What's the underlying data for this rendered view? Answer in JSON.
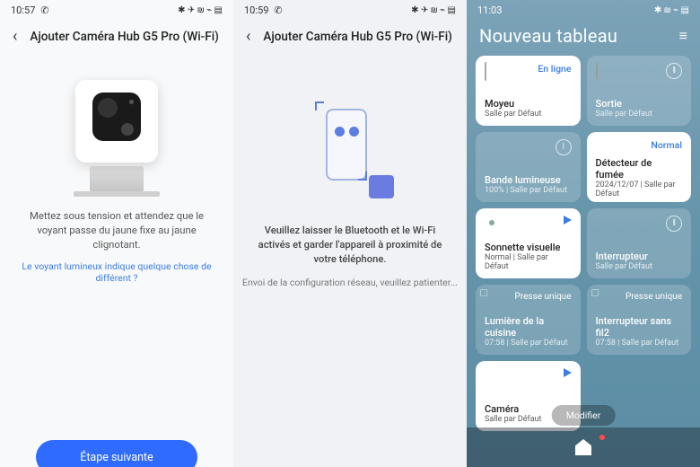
{
  "screen1": {
    "time": "10:57",
    "status_icons": "✱ ⚡ ⚲ ⛢ ⚞ ⚡",
    "title": "Ajouter Caméra Hub G5 Pro (Wi-Fi)",
    "instruction": "Mettez sous tension et attendez que le voyant passe du jaune fixe au jaune clignotant.",
    "help_link": "Le voyant lumineux indique quelque chose de différent ?",
    "next_button": "Étape suivante"
  },
  "screen2": {
    "time": "10:59",
    "title": "Ajouter Caméra Hub G5 Pro (Wi-Fi)",
    "instruction": "Veuillez laisser le Bluetooth et le Wi-Fi activés et garder l'appareil à proximité de votre téléphone.",
    "sending": "Envoi de la configuration réseau, veuillez patienter..."
  },
  "screen3": {
    "time": "11:03",
    "board_title": "Nouveau tableau",
    "modify": "Modifier",
    "tiles": [
      {
        "name": "Moyeu",
        "sub": "Salle par Défaut",
        "state": "En ligne",
        "state_kind": "online",
        "tone": "light",
        "icon": "hub"
      },
      {
        "name": "Sortie",
        "sub": "Salle par Défaut",
        "state_kind": "power",
        "tone": "dark",
        "icon": "outlet"
      },
      {
        "name": "Bande lumineuse",
        "sub": "100% | Salle par Défaut",
        "state_kind": "power",
        "tone": "dark",
        "icon": "bulb"
      },
      {
        "name": "Détecteur de fumée",
        "sub": "2024/12/07 | Salle par Défaut",
        "state": "Normal",
        "state_kind": "normal",
        "tone": "light",
        "icon": "flame"
      },
      {
        "name": "Sonnette visuelle",
        "sub": "Normal | Salle par Défaut",
        "state_kind": "play",
        "tone": "light",
        "icon": "bell"
      },
      {
        "name": "Interrupteur",
        "sub": "Salle par Défaut",
        "state_kind": "power",
        "tone": "dark",
        "icon": "switch"
      },
      {
        "name": "Lumière de la cuisine",
        "sub": "07:58 | Salle par Défaut",
        "state": "Presse unique",
        "state_kind": "press",
        "tone": "dark",
        "icon": "switch",
        "popout": true
      },
      {
        "name": "Interrupteur sans fil2",
        "sub": "07:58 | Salle par Défaut",
        "state": "Presse unique",
        "state_kind": "press",
        "tone": "dark",
        "icon": "switch",
        "popout": true
      },
      {
        "name": "Caméra",
        "sub": "Salle par Défaut",
        "state_kind": "play",
        "tone": "light",
        "icon": "cam"
      }
    ]
  }
}
